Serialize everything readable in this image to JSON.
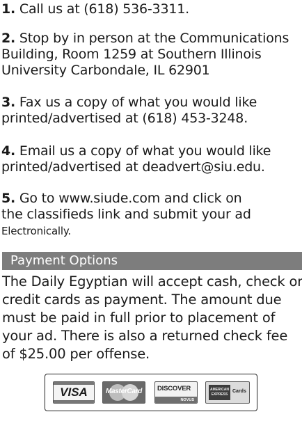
{
  "steps": [
    {
      "num": "1.",
      "lines": [
        "Call us at (618) 536-3311."
      ]
    },
    {
      "num": "2.",
      "lines": [
        "Stop by in person at the Communications",
        "Building, Room 1259 at Southern Illinois",
        "University Carbondale, IL 62901"
      ]
    },
    {
      "num": "3.",
      "lines": [
        "Fax us a copy of what you would like",
        "printed/advertised at (618) 453-3248."
      ]
    },
    {
      "num": "4.",
      "lines": [
        "Email us a copy of what you would like",
        "printed/advertised at deadvert@siu.edu."
      ]
    },
    {
      "num": "5.",
      "lines": [
        "Go to www.siude.com and click on",
        "the classifieds link and submit your ad"
      ],
      "small_line": "Electronically."
    }
  ],
  "payment": {
    "header": "Payment Options",
    "lines": [
      "The Daily Egyptian will accept cash, check or",
      "credit cards as payment. The amount due",
      "must be paid in full prior to placement of",
      "your ad. There is also a returned check fee",
      "of $25.00 per offense."
    ]
  },
  "cards": {
    "visa": "VISA",
    "mastercard": "MasterCard",
    "discover": "DISCOVER",
    "discover_novus": "NOVUS",
    "amex_line1": "AMERICAN",
    "amex_line2": "EXPRESS",
    "amex_cards": "Cards"
  },
  "colors": {
    "header_bg": "#7d7d7d",
    "header_text": "#ffffff",
    "body_text": "#1a1a1a"
  }
}
